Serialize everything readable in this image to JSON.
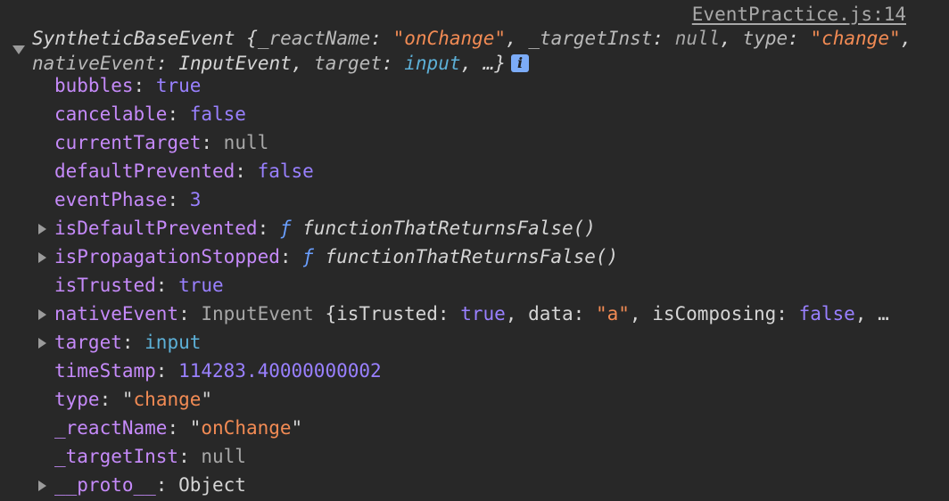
{
  "source_link": "EventPractice.js:14",
  "summary": {
    "class_name": "SyntheticBaseEvent",
    "parts": [
      {
        "key": "_reactName",
        "value": "\"onChange\"",
        "type": "string"
      },
      {
        "key": "_targetInst",
        "value": "null",
        "type": "null"
      },
      {
        "key": "type",
        "value": "\"change\"",
        "type": "string"
      },
      {
        "key": "nativeEvent",
        "value": "InputEvent",
        "type": "plain"
      },
      {
        "key": "target",
        "value": "input",
        "type": "ref"
      }
    ],
    "ellipsis": "…",
    "info_icon": "i"
  },
  "properties": [
    {
      "key": "bubbles",
      "value": "true",
      "type": "kw",
      "expandable": false
    },
    {
      "key": "cancelable",
      "value": "false",
      "type": "kw",
      "expandable": false
    },
    {
      "key": "currentTarget",
      "value": "null",
      "type": "null",
      "expandable": false
    },
    {
      "key": "defaultPrevented",
      "value": "false",
      "type": "kw",
      "expandable": false
    },
    {
      "key": "eventPhase",
      "value": "3",
      "type": "num",
      "expandable": false
    },
    {
      "key": "isDefaultPrevented",
      "value": "functionThatReturnsFalse()",
      "type": "fn",
      "expandable": true
    },
    {
      "key": "isPropagationStopped",
      "value": "functionThatReturnsFalse()",
      "type": "fn",
      "expandable": true
    },
    {
      "key": "isTrusted",
      "value": "true",
      "type": "kw",
      "expandable": false
    },
    {
      "key": "nativeEvent",
      "value": "",
      "type": "native",
      "expandable": true,
      "class_name": "InputEvent",
      "preview": [
        {
          "key": "isTrusted",
          "value": "true",
          "type": "kw"
        },
        {
          "key": "data",
          "value": "\"a\"",
          "type": "str"
        },
        {
          "key": "isComposing",
          "value": "false",
          "type": "kw"
        }
      ]
    },
    {
      "key": "target",
      "value": "input",
      "type": "ref",
      "expandable": true
    },
    {
      "key": "timeStamp",
      "value": "114283.40000000002",
      "type": "num",
      "expandable": false
    },
    {
      "key": "type",
      "value": "\"change\"",
      "type": "str-quoted",
      "expandable": false
    },
    {
      "key": "_reactName",
      "value": "\"onChange\"",
      "type": "str-quoted",
      "expandable": false
    },
    {
      "key": "_targetInst",
      "value": "null",
      "type": "null",
      "expandable": false
    },
    {
      "key": "__proto__",
      "value": "Object",
      "type": "plain",
      "expandable": true
    }
  ],
  "colors": {
    "background": "#282828",
    "key": "#c58af9",
    "string": "#f28b54",
    "keyword": "#9980ff",
    "null": "#a8a8a8",
    "ref": "#5db0d7",
    "info_badge": "#7cacf8"
  }
}
